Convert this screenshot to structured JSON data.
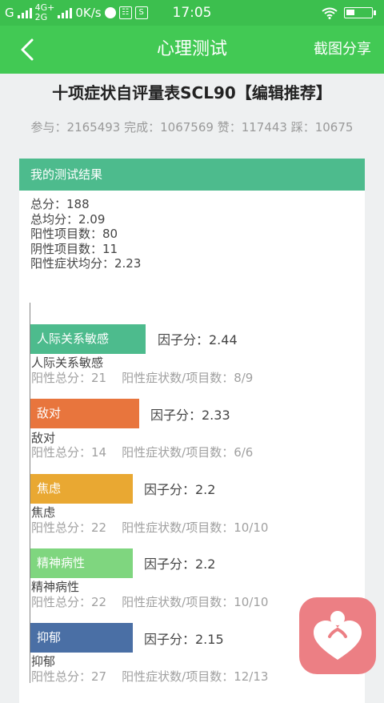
{
  "statusbar": {
    "sim_label": "G",
    "net_top": "4G+",
    "net_bottom": "2G",
    "speed": "0K/s",
    "time": "17:05"
  },
  "nav": {
    "title": "心理测试",
    "share_label": "截图分享"
  },
  "test": {
    "title": "十项症状自评量表SCL90【编辑推荐】",
    "stats": "参与：2165493 完成：1067569 赞：117443 踩：10675"
  },
  "result": {
    "header": "我的测试结果",
    "lines": [
      "总分：188",
      "总均分：2.09",
      "阳性项目数：80",
      "阴性项目数：11",
      "阳性症状均分：2.23"
    ]
  },
  "factors": [
    {
      "name": "人际关系敏感",
      "score": 2.44,
      "factor_label": "因子分：2.44",
      "detail": "阳性总分：21    阳性症状数/项目数：8/9",
      "color": "#4dbb8d"
    },
    {
      "name": "敌对",
      "score": 2.33,
      "factor_label": "因子分：2.33",
      "detail": "阳性总分：14    阳性症状数/项目数：6/6",
      "color": "#e8753d"
    },
    {
      "name": "焦虑",
      "score": 2.2,
      "factor_label": "因子分：2.2",
      "detail": "阳性总分：22    阳性症状数/项目数：10/10",
      "color": "#e9a832"
    },
    {
      "name": "精神病性",
      "score": 2.2,
      "factor_label": "因子分：2.2",
      "detail": "阳性总分：22    阳性症状数/项目数：10/10",
      "color": "#7fd67f"
    },
    {
      "name": "抑郁",
      "score": 2.15,
      "factor_label": "因子分：2.15",
      "detail": "阳性总分：27    阳性症状数/项目数：12/13",
      "color": "#4a6fa5"
    }
  ]
}
